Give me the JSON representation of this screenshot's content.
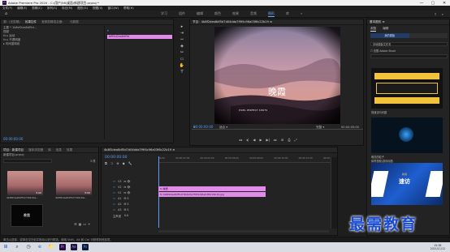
{
  "window": {
    "title": "Adobe Premiere Pro 2020 - C:\\用户\\56\\桌面\\新建项目.prproj *",
    "controls": [
      "—",
      "▢",
      "✕"
    ]
  },
  "menu": [
    "文件(F)",
    "编辑(E)",
    "剪辑(C)",
    "序列(S)",
    "标记(M)",
    "图形(G)",
    "视图(V)",
    "窗口(W)",
    "帮助(H)"
  ],
  "workspaces": {
    "tabs": [
      "学习",
      "组件",
      "编辑",
      "颜色",
      "效果",
      "音频",
      "图形",
      "库",
      "»"
    ],
    "active_index": 6,
    "right_icons": [
      "⇪",
      "⌕"
    ]
  },
  "source_panel": {
    "tabs": [
      "源：(无剪辑)",
      "效果控件",
      "音频剪辑混合器：",
      "元数据",
      "节目：4b8f2de..."
    ],
    "rows": [
      "主要 * 1b8ef2ea8df5d...",
      "视频",
      "fx ▸ 运动",
      "fx ▸ 不透明度",
      "▸ 时间重映射"
    ],
    "timecode": "00:00:00:00",
    "clip_label": "bfff4d2ea8df5d"
  },
  "program_monitor": {
    "title": "节目：4b8f2dea8df5d7d04dda7f9f4c96a03f6c22b19 ≡",
    "overlay_text": "晚霞",
    "caption": "PIXEL PERFECT SHOTS",
    "timecode_left": "00:00:00:00",
    "fit": "适合",
    "quality": "完整",
    "timecode_right": "00:00:05:00",
    "controls": [
      "◂◂",
      "◂|",
      "◀",
      "▶",
      "▶|",
      "▸▸",
      "⊞",
      "⎙",
      "⤢"
    ]
  },
  "project_panel": {
    "tabs": [
      "项目：新建项目",
      "媒体浏览器",
      "库",
      "信息",
      "效果",
      "»"
    ],
    "project_name": "新建项目.prproj",
    "item_count": "3 项",
    "search_placeholder": "",
    "items": [
      {
        "name": "4b8f2dea8df5d7d04dda...",
        "duration": "5:00"
      },
      {
        "name": "4b8f2dea8df5d7d04dda...",
        "duration": "5:00"
      },
      {
        "name": "晚霞",
        "duration": "5:00"
      }
    ]
  },
  "tools": [
    "▸",
    "⇥",
    "⇿",
    "◈",
    "✂",
    "▭",
    "✋",
    "T"
  ],
  "timeline": {
    "tab": "4b8f2dea8df5d7d04dda7f9f4c96a03f6c22b19 ≡",
    "timecode": "00:00:00:00",
    "ruler": [
      "00:00",
      "00:00:02:00",
      "00:00:04:00",
      "00:00:06:00",
      "00:00:08:00",
      "00:00:10:00",
      "00:00:12:00",
      "00:00:14:00"
    ],
    "tracks": [
      "V3",
      "V2",
      "V1",
      "A1",
      "A2",
      "A3",
      "主声道"
    ],
    "master_value": "0.0",
    "clips": [
      {
        "label": "fx 晚霞",
        "track": "V2"
      },
      {
        "label": "fx 4b8f2dea8df5d7d04dda7f9f4c96a03f6c22b19.jpg",
        "track": "V1"
      }
    ]
  },
  "essential_graphics": {
    "title": "基本图形 ≡",
    "tabs": [
      "浏览",
      "编辑"
    ],
    "active_tab": "我的模板",
    "dropdown": "本地模板文件夹",
    "checkbox": "仅限 Adobe Stock",
    "templates": [
      {
        "label": "",
        "caption": "快速访问问题"
      },
      {
        "label": "",
        "caption": "新闻标题 - 流行"
      },
      {
        "label": "",
        "caption": "明亮的粒子"
      },
      {
        "label": "摄影",
        "caption": "体育视频/游戏标题"
      }
    ],
    "sport_text": "速访",
    "sport_sub": "新闻"
  },
  "watermark": "最需教育",
  "status": "单击以选择，或单击空白处并拖动以进行框选。使用 Shift、Alt 和 Ctrl 可获得其他选项。",
  "taskbar": {
    "search_placeholder": "在这里输入你要搜索的内容",
    "time": "15:38",
    "date": "2021/11/12",
    "icons": [
      "⊞",
      "⌕",
      "◷",
      "e",
      "📁",
      "Pr",
      "Ae",
      "Ps"
    ]
  },
  "colors": {
    "accent": "#5a9cf8",
    "clip": "#e38be8",
    "template_yellow": "#f2c23a",
    "watermark": "#1b4bd1"
  }
}
